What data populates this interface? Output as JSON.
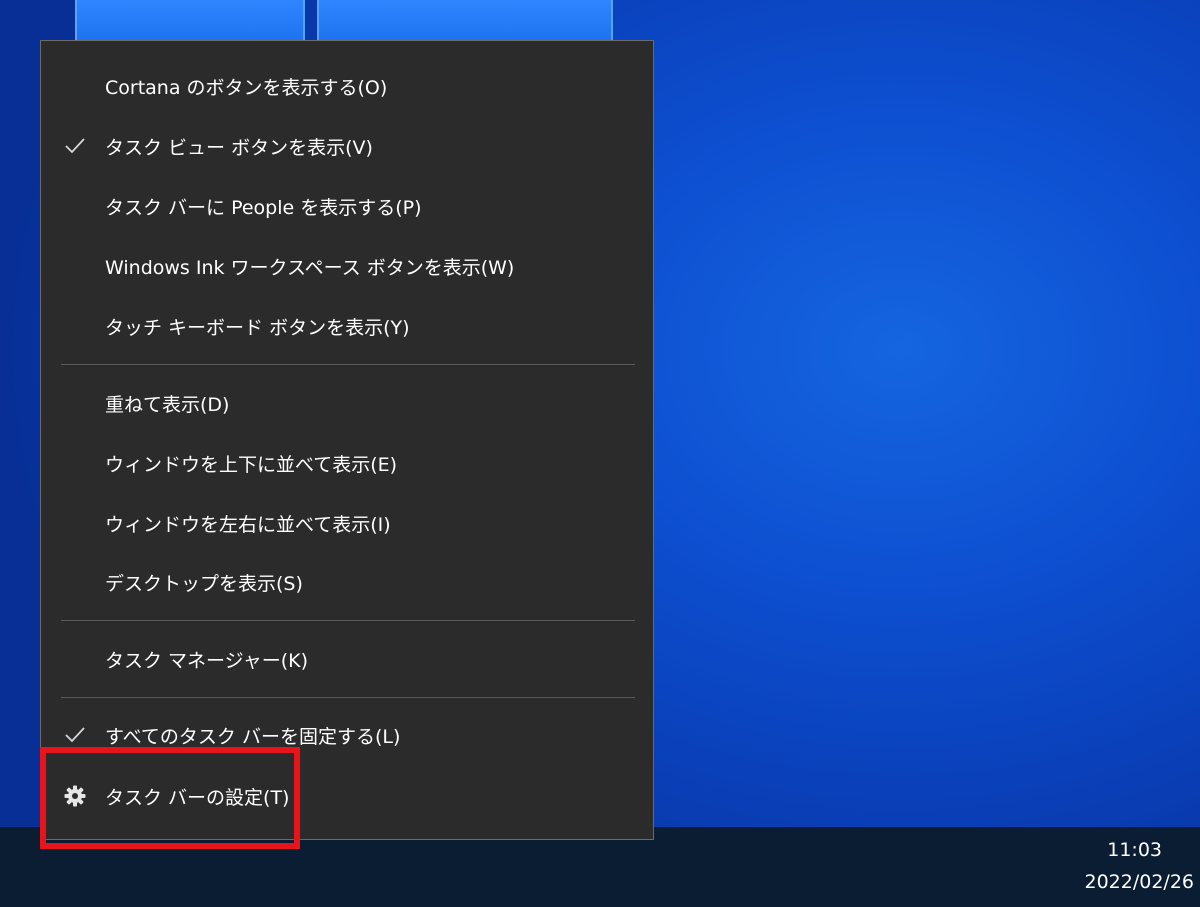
{
  "context_menu": {
    "items": [
      {
        "label": "Cortana のボタンを表示する(O)",
        "checked": false
      },
      {
        "label": "タスク ビュー ボタンを表示(V)",
        "checked": true
      },
      {
        "label": "タスク バーに People を表示する(P)",
        "checked": false
      },
      {
        "label": "Windows Ink ワークスペース ボタンを表示(W)",
        "checked": false
      },
      {
        "label": "タッチ キーボード ボタンを表示(Y)",
        "checked": false
      },
      {
        "label": "重ねて表示(D)",
        "checked": false
      },
      {
        "label": "ウィンドウを上下に並べて表示(E)",
        "checked": false
      },
      {
        "label": "ウィンドウを左右に並べて表示(I)",
        "checked": false
      },
      {
        "label": "デスクトップを表示(S)",
        "checked": false
      },
      {
        "label": "タスク マネージャー(K)",
        "checked": false
      },
      {
        "label": "すべてのタスク バーを固定する(L)",
        "checked": true
      },
      {
        "label": "タスク バーの設定(T)",
        "icon": "gear-icon",
        "highlighted": true
      }
    ]
  },
  "taskbar": {
    "time": "11:03",
    "date": "2022/02/26"
  },
  "colors": {
    "menu_background": "#2b2b2b",
    "highlight": "#e8141c",
    "desktop_blue": "#0d4fd0",
    "taskbar": "#0a1d33"
  }
}
